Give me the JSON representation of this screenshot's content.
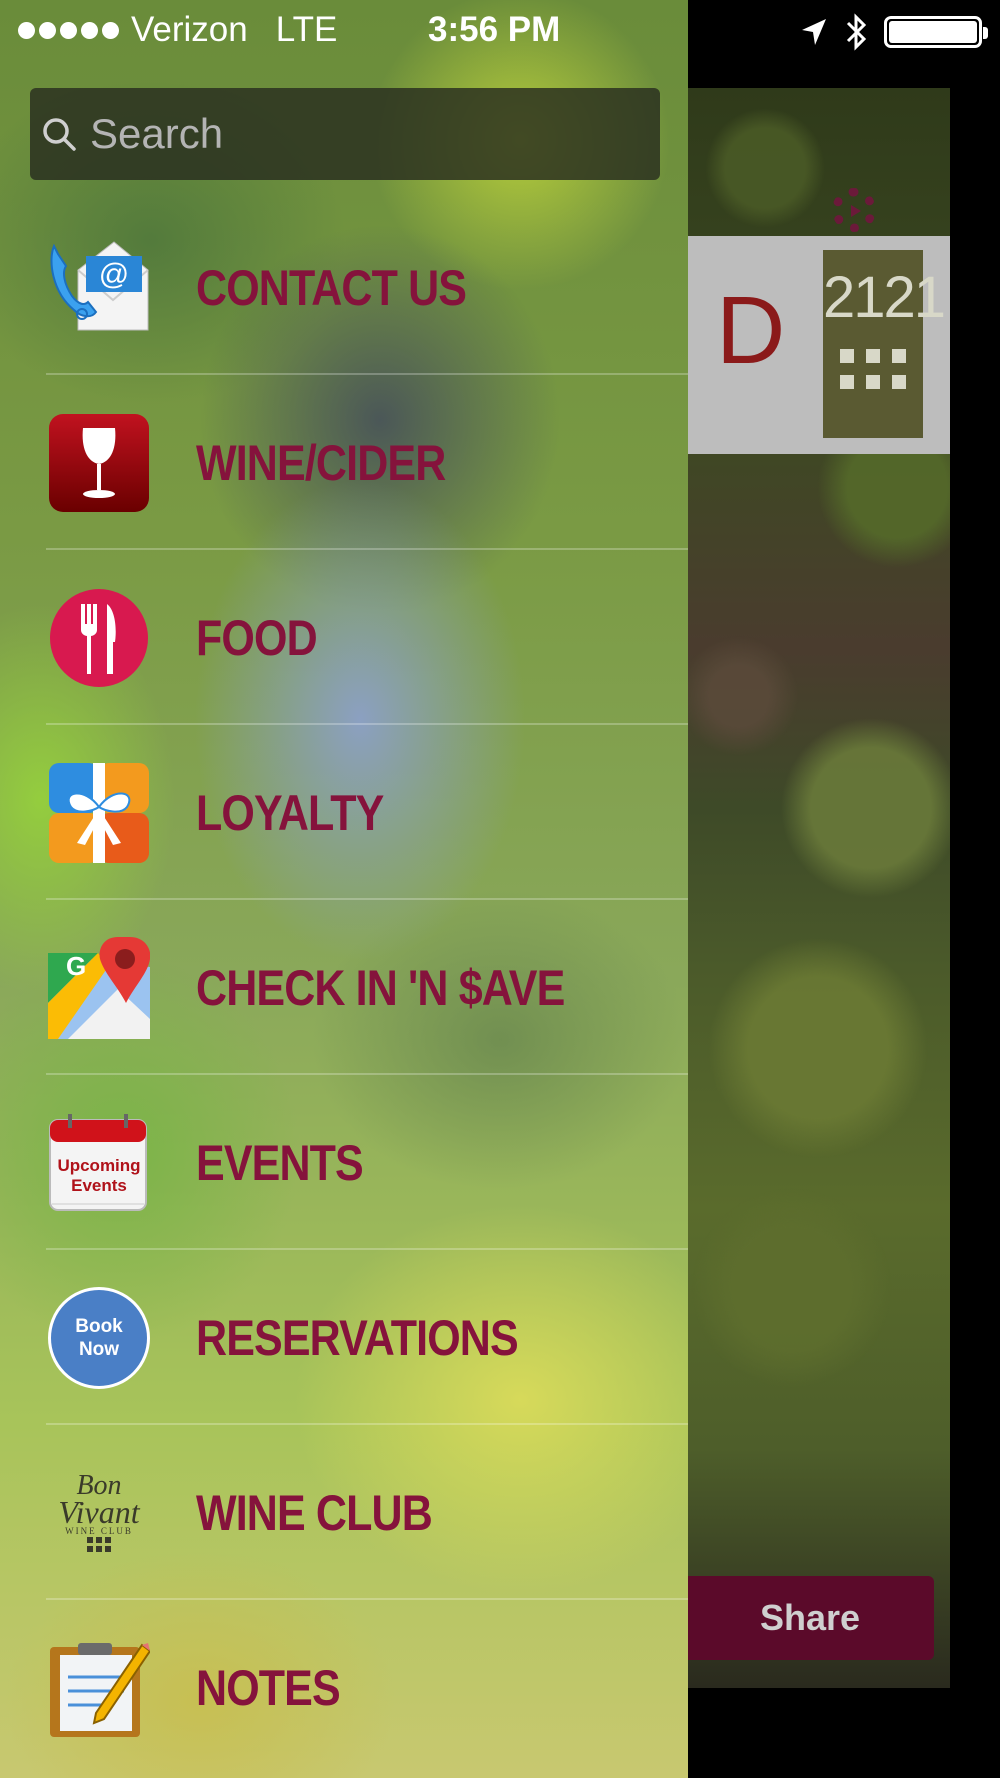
{
  "status_bar": {
    "carrier": "Verizon",
    "network": "LTE",
    "time": "3:56 PM"
  },
  "search": {
    "placeholder": "Search"
  },
  "menu": [
    {
      "label": "CONTACT US",
      "icon": "contact-icon"
    },
    {
      "label": "WINE/CIDER",
      "icon": "wine-glass-icon"
    },
    {
      "label": "FOOD",
      "icon": "fork-knife-icon"
    },
    {
      "label": "LOYALTY",
      "icon": "gift-icon"
    },
    {
      "label": "CHECK IN 'N $AVE",
      "icon": "map-pin-icon"
    },
    {
      "label": "EVENTS",
      "icon": "calendar-icon",
      "icon_text": [
        "Upcoming",
        "Events"
      ]
    },
    {
      "label": "RESERVATIONS",
      "icon": "book-now-icon",
      "icon_text": [
        "Book",
        "Now"
      ]
    },
    {
      "label": "WINE CLUB",
      "icon": "wine-club-logo-icon",
      "icon_text": [
        "Bon",
        "Vivant",
        "WINE CLUB"
      ]
    },
    {
      "label": "NOTES",
      "icon": "notepad-icon"
    }
  ],
  "background_app": {
    "logo_number": "2121",
    "logo_letter": "D",
    "share_label": "Share"
  },
  "colors": {
    "menu_text": "#85133c",
    "share_button": "#5b0a2a"
  }
}
